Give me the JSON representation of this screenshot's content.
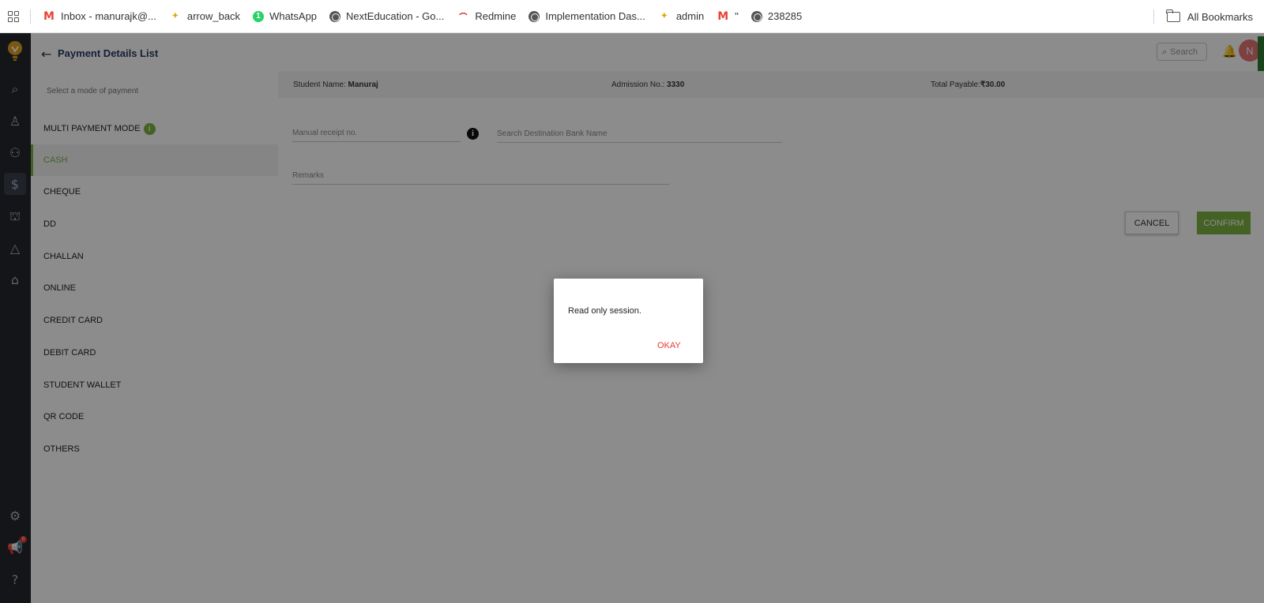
{
  "bookmarks": [
    {
      "icon": "gmail-icon",
      "label": "Inbox - manurajk@..."
    },
    {
      "icon": "sparkle-icon",
      "label": "arrow_back"
    },
    {
      "icon": "whatsapp-icon",
      "label": "WhatsApp"
    },
    {
      "icon": "globe-icon",
      "label": "NextEducation - Go..."
    },
    {
      "icon": "redmine-icon",
      "label": "Redmine"
    },
    {
      "icon": "globe-icon",
      "label": "Implementation Das..."
    },
    {
      "icon": "sparkle-icon",
      "label": "admin"
    },
    {
      "icon": "gmail-icon",
      "label": "\""
    },
    {
      "icon": "globe-icon",
      "label": "238285"
    }
  ],
  "all_bookmarks": "All Bookmarks",
  "header": {
    "title": "Payment Details List",
    "search_placeholder": "Search",
    "avatar_letter": "N"
  },
  "rail": {
    "notification_count": "0"
  },
  "modes": {
    "hint": "Select a mode of payment",
    "multi": "MULTI PAYMENT MODE",
    "multi_info": "i",
    "items": [
      "CASH",
      "CHEQUE",
      "DD",
      "CHALLAN",
      "ONLINE",
      "CREDIT CARD",
      "DEBIT CARD",
      "STUDENT WALLET",
      "QR CODE",
      "OTHERS"
    ],
    "active": "CASH"
  },
  "student": {
    "name_label": "Student Name:",
    "name": "Manuraj",
    "admission_label": "Admission No.:",
    "admission": "3330",
    "payable_label": "Total Payable:",
    "payable": "₹30.00"
  },
  "form": {
    "manual_receipt": "Manual receipt no.",
    "bank_search": "Search Destination Bank Name",
    "remarks": "Remarks",
    "info": "i"
  },
  "actions": {
    "cancel": "CANCEL",
    "confirm": "CONFIRM"
  },
  "dialog": {
    "message": "Read only session.",
    "ok": "OKAY"
  }
}
